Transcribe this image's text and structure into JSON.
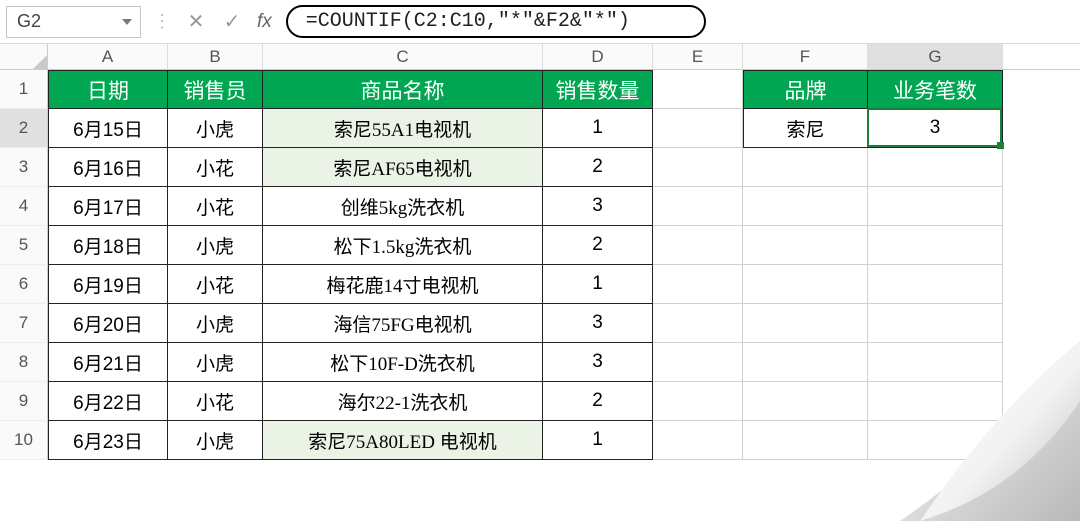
{
  "formula_bar": {
    "cell_ref": "G2",
    "cancel": "✕",
    "confirm": "✓",
    "fx": "fx",
    "formula": "=COUNTIF(C2:C10,\"*\"&F2&\"*\")"
  },
  "columns": [
    "A",
    "B",
    "C",
    "D",
    "E",
    "F",
    "G"
  ],
  "row_numbers": [
    "1",
    "2",
    "3",
    "4",
    "5",
    "6",
    "7",
    "8",
    "9",
    "10"
  ],
  "active_col_index": 6,
  "active_row_index": 1,
  "main_table": {
    "headers": {
      "A": "日期",
      "B": "销售员",
      "C": "商品名称",
      "D": "销售数量"
    },
    "rows": [
      {
        "A": "6月15日",
        "B": "小虎",
        "C": "索尼55A1电视机",
        "D": "1",
        "hl": true
      },
      {
        "A": "6月16日",
        "B": "小花",
        "C": "索尼AF65电视机",
        "D": "2",
        "hl": true
      },
      {
        "A": "6月17日",
        "B": "小花",
        "C": "创维5kg洗衣机",
        "D": "3",
        "hl": false
      },
      {
        "A": "6月18日",
        "B": "小虎",
        "C": "松下1.5kg洗衣机",
        "D": "2",
        "hl": false
      },
      {
        "A": "6月19日",
        "B": "小花",
        "C": "梅花鹿14寸电视机",
        "D": "1",
        "hl": false
      },
      {
        "A": "6月20日",
        "B": "小虎",
        "C": "海信75FG电视机",
        "D": "3",
        "hl": false
      },
      {
        "A": "6月21日",
        "B": "小虎",
        "C": "松下10F-D洗衣机",
        "D": "3",
        "hl": false
      },
      {
        "A": "6月22日",
        "B": "小花",
        "C": "海尔22-1洗衣机",
        "D": "2",
        "hl": false
      },
      {
        "A": "6月23日",
        "B": "小虎",
        "C": "索尼75A80LED 电视机",
        "D": "1",
        "hl": true
      }
    ]
  },
  "side_table": {
    "headers": {
      "F": "品牌",
      "G": "业务笔数"
    },
    "row": {
      "F": "索尼",
      "G": "3"
    }
  }
}
